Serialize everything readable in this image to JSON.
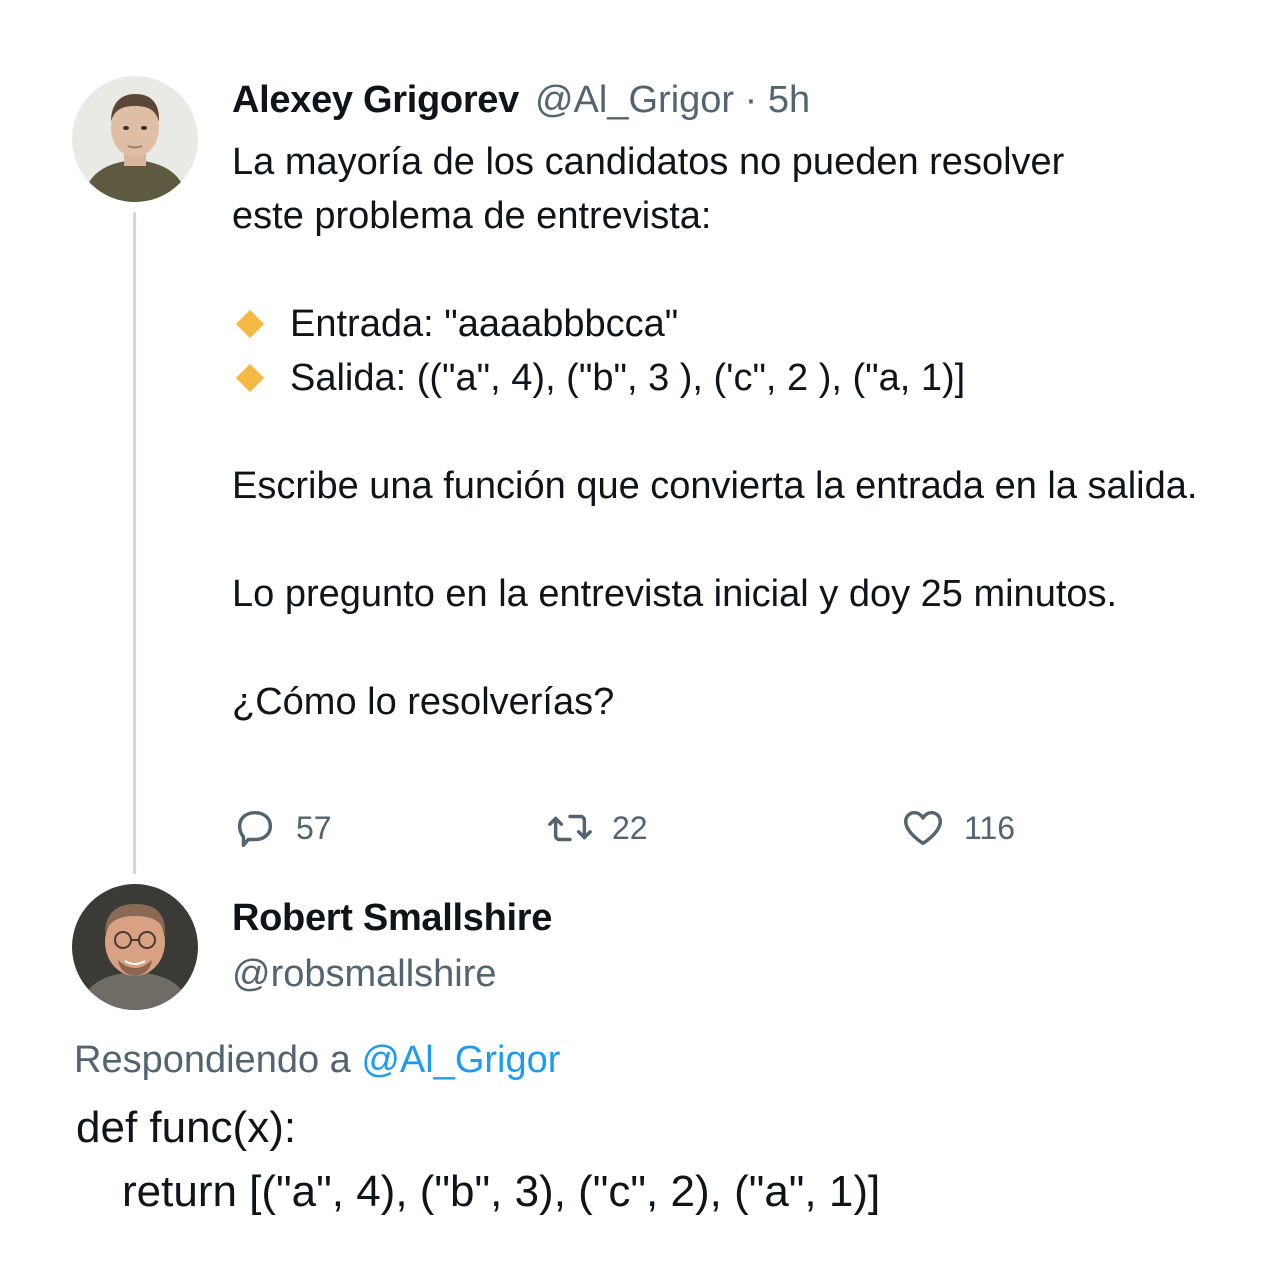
{
  "tweet": {
    "author_name": "Alexey Grigorev",
    "author_handle": "@Al_Grigor",
    "separator": "·",
    "time": "5h",
    "line1": "La mayoría de los candidatos no  pueden resolver",
    "line2": "este problema de entrevista:",
    "bullet1": "Entrada: \"aaaabbbcca\"",
    "bullet2": "Salida:  ((\"a\", 4), (\"b\", 3 ),  ('c\", 2 ), (\"a, 1)]",
    "para2": "Escribe una función que convierta la entrada en la salida.",
    "para3": "Lo pregunto en la entrevista inicial  y  doy 25 minutos.",
    "para4": "¿Cómo lo resolverías?",
    "replies": "57",
    "retweets": "22",
    "likes": "116"
  },
  "reply": {
    "author_name": "Robert Smallshire",
    "author_handle": "@robsmallshire",
    "replying_prefix": "Respondiendo a ",
    "replying_to": "@Al_Grigor",
    "code_line1": "def func(x):",
    "code_line2": "return [(\"a\", 4), (\"b\", 3), (\"c\", 2), (\"a\", 1)]"
  },
  "icons": {
    "bullet": "orange-diamond-icon",
    "reply": "speech-bubble-icon",
    "retweet": "retweet-arrows-icon",
    "like": "heart-icon"
  },
  "colors": {
    "text": "#0f1419",
    "secondary": "#536471",
    "link": "#1d9bf0",
    "bullet": "#f4b942",
    "thread_line": "#cfd9de"
  }
}
